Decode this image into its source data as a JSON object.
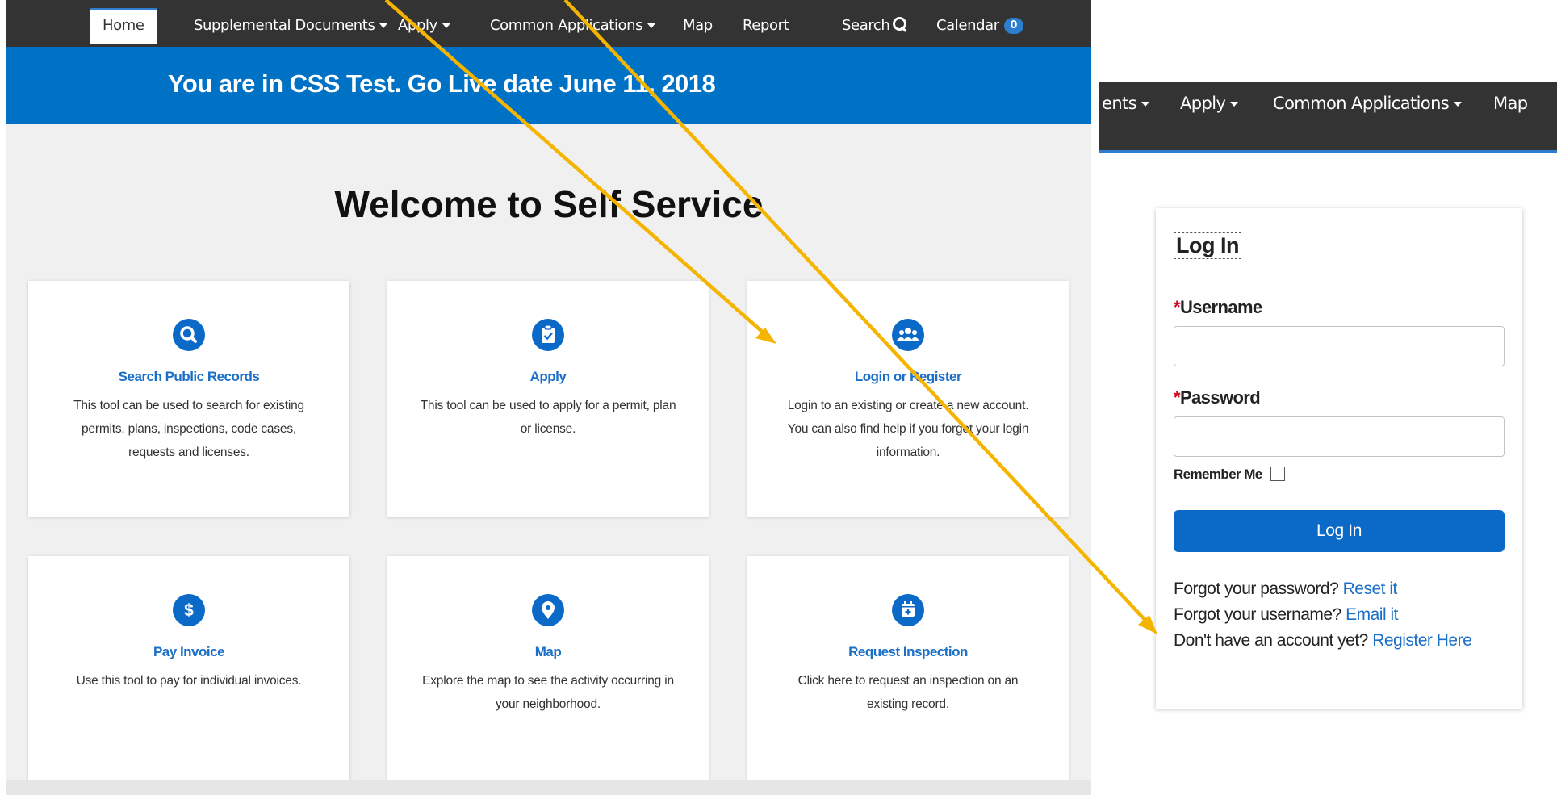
{
  "nav": {
    "home": "Home",
    "supplemental": "Supplemental Documents",
    "apply": "Apply",
    "common": "Common Applications",
    "map": "Map",
    "report": "Report",
    "search": "Search",
    "calendar": "Calendar",
    "calendar_count": "0"
  },
  "banner": {
    "text": "You are in CSS Test.  Go Live date June 11, 2018"
  },
  "welcome": "Welcome to Self Service",
  "cards": [
    {
      "icon": "search-icon",
      "title": "Search Public Records",
      "desc": "This tool can be used to search for existing permits, plans, inspections, code cases, requests and licenses."
    },
    {
      "icon": "clipboard-check-icon",
      "title": "Apply",
      "desc": "This tool can be used to apply for a permit, plan or license."
    },
    {
      "icon": "users-icon",
      "title": "Login or Register",
      "desc": "Login to an existing or create a new account. You can also find help if you forgot your login information."
    },
    {
      "icon": "dollar-icon",
      "title": "Pay Invoice",
      "desc": "Use this tool to pay for individual invoices."
    },
    {
      "icon": "map-marker-icon",
      "title": "Map",
      "desc": "Explore the map to see the activity occurring in your neighborhood."
    },
    {
      "icon": "calendar-plus-icon",
      "title": "Request Inspection",
      "desc": "Click here to request an inspection on an existing record."
    }
  ],
  "right_nav": {
    "partial": "ents",
    "apply": "Apply",
    "common": "Common Applications",
    "map": "Map"
  },
  "login": {
    "title": "Log In",
    "required_mark": "*",
    "username_label": "Username",
    "username_value": "",
    "password_label": "Password",
    "password_value": "",
    "remember_label": "Remember Me",
    "button": "Log In",
    "forgot_password": "Forgot your password?",
    "reset_link": "Reset it",
    "forgot_username": "Forgot your username?",
    "email_link": "Email it",
    "no_account": "Don't have an account yet?",
    "register_link": "Register Here"
  },
  "colors": {
    "nav_bg": "#333333",
    "banner_bg": "#0072c6",
    "accent": "#0b69c7",
    "link": "#1b6fc7",
    "arrow": "#f5b400",
    "required": "#d0021b"
  }
}
